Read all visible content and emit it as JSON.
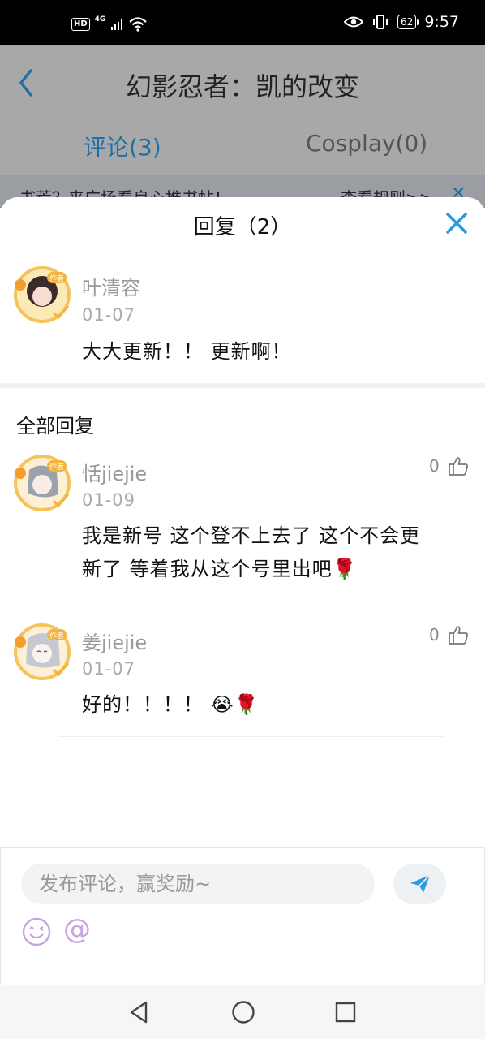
{
  "status_bar": {
    "hd": "HD",
    "network": "4G",
    "battery": "62",
    "time": "9:57"
  },
  "background_page": {
    "title": "幻影忍者：凯的改变",
    "tabs": [
      {
        "label": "评论(3)",
        "active": true
      },
      {
        "label": "Cosplay(0)",
        "active": false
      }
    ],
    "notice": {
      "text": "书荒？来广场看良心推书帖！",
      "link": "查看规则>>"
    }
  },
  "sheet": {
    "title": "回复（2）",
    "original_comment": {
      "author": "叶清容",
      "date": "01-07",
      "content": "大大更新！！ 更新啊！",
      "badge": "作者"
    },
    "section_title": "全部回复",
    "replies": [
      {
        "author": "恬jiejie",
        "date": "01-09",
        "content_line1": "我是新号 这个登不上去了 这个不会更",
        "content_line2": "新了 等着我从这个号里出吧🌹",
        "likes": "0",
        "badge": "作者"
      },
      {
        "author": "姜jiejie",
        "date": "01-07",
        "content_line1": "好的！！！！ 😭🌹",
        "likes": "0",
        "badge": "作者"
      }
    ]
  },
  "composer": {
    "placeholder": "发布评论，赢奖励~",
    "mention": "@"
  },
  "colors": {
    "accent_blue": "#2a9be0",
    "mention_purple": "#c7a3e3"
  },
  "icons": [
    "back-arrow-icon",
    "close-icon",
    "thumbs-up-icon",
    "send-icon",
    "emoji-icon",
    "nav-back-icon",
    "nav-home-icon",
    "nav-recent-icon"
  ]
}
